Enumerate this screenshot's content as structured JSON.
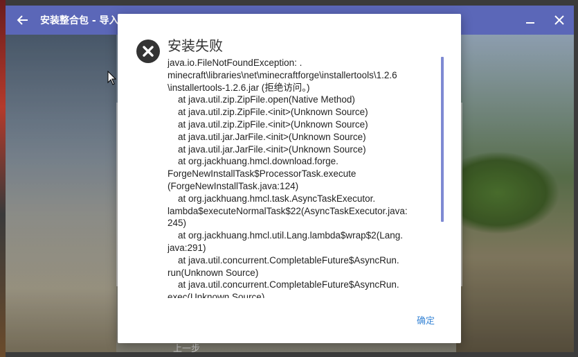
{
  "window": {
    "title": "安装整合包 - 导入",
    "bottom_link": "上一步"
  },
  "dialog": {
    "title": "安装失败",
    "message": "java.io.FileNotFoundException: .\nminecraft\\libraries\\net\\minecraftforge\\installertools\\1.2.6\n\\installertools-1.2.6.jar (拒绝访问。)\n\tat java.util.zip.ZipFile.open(Native Method)\n\tat java.util.zip.ZipFile.<init>(Unknown Source)\n\tat java.util.zip.ZipFile.<init>(Unknown Source)\n\tat java.util.jar.JarFile.<init>(Unknown Source)\n\tat java.util.jar.JarFile.<init>(Unknown Source)\n\tat org.jackhuang.hmcl.download.forge.\nForgeNewInstallTask$ProcessorTask.execute\n(ForgeNewInstallTask.java:124)\n\tat org.jackhuang.hmcl.task.AsyncTaskExecutor.\nlambda$executeNormalTask$22(AsyncTaskExecutor.java:\n245)\n\tat org.jackhuang.hmcl.util.Lang.lambda$wrap$2(Lang.\njava:291)\n\tat java.util.concurrent.CompletableFuture$AsyncRun.\nrun(Unknown Source)\n\tat java.util.concurrent.CompletableFuture$AsyncRun.\nexec(Unknown Source)",
    "confirm_label": "确定"
  },
  "icons": {
    "dialog_icon": "error-circle-icon",
    "back": "arrow-left-icon",
    "minimize": "minimize-icon",
    "close": "close-icon"
  },
  "colors": {
    "titlebar": "#5b67b8",
    "accent": "#3a86d6",
    "scrollbar": "#7e8ad3"
  }
}
